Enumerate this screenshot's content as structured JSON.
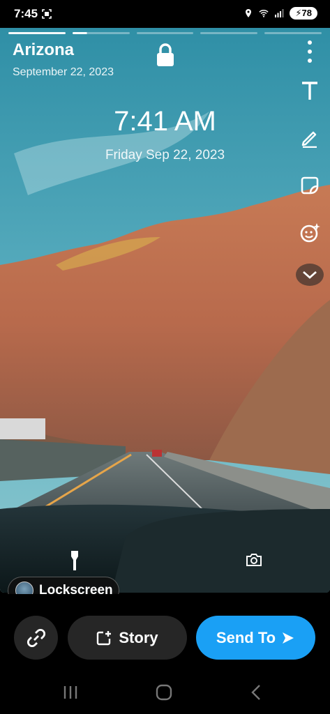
{
  "status_bar": {
    "time": "7:45",
    "battery": "78"
  },
  "story": {
    "location": "Arizona",
    "date": "September 22, 2023",
    "capture_time": "7:41 AM",
    "capture_date": "Friday Sep 22, 2023",
    "progress_segments": 5
  },
  "tools": [
    "text-tool",
    "pen-tool",
    "sticker-tool",
    "emoji-tool",
    "expand-tools"
  ],
  "lockscreen_chip": {
    "label": "Lockscreen"
  },
  "actions": {
    "story_label": "Story",
    "send_label": "Send To"
  },
  "colors": {
    "send_button": "#1aa0f5",
    "dark_button": "#262626"
  }
}
